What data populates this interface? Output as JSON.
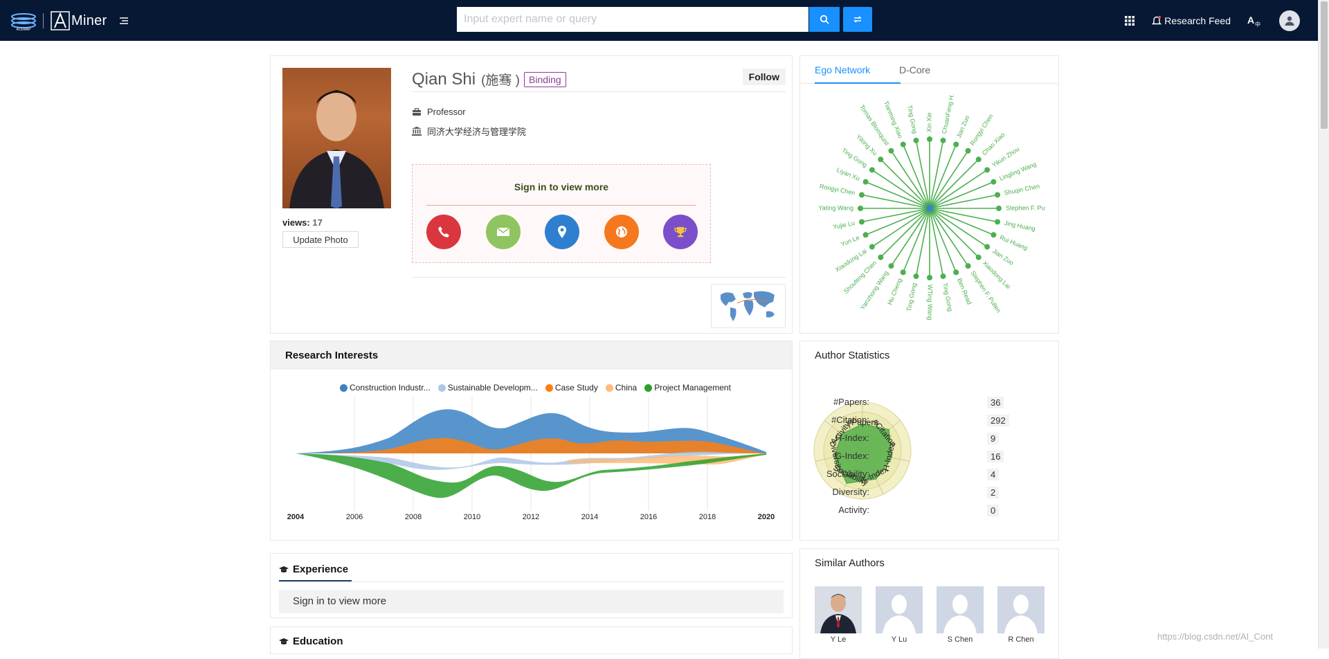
{
  "nav": {
    "brand": "Miner",
    "search_placeholder": "Input expert name or query",
    "research_feed": "Research Feed"
  },
  "profile": {
    "name": "Qian Shi",
    "chinese_name": "(施骞 )",
    "binding": "Binding",
    "follow": "Follow",
    "title": "Professor",
    "affiliation": "同济大学经济与管理学院",
    "views_label": "views:",
    "views_count": "17",
    "update_photo": "Update Photo",
    "signin_prompt": "Sign in to view more"
  },
  "ego": {
    "tabs": [
      "Ego Network",
      "D-Core"
    ],
    "nodes": [
      "Xin Xie",
      "ChuanFeng H.",
      "Jian Zuo",
      "Rongyi Chen",
      "Chao Xiao",
      "Yikun Zhou",
      "Lingling Wang",
      "Shuqin Chen",
      "Stephen F. Pu",
      "Jing Huang",
      "Rui Huang",
      "Jian Zuo",
      "Xiaodong Lai",
      "Stephen F. Pullen",
      "Ben Read",
      "Ting Gong",
      "WTing Wang",
      "Ting Gong",
      "Hu Cheng",
      "Yanzhong Wang",
      "Shoufeng Chen",
      "Xiaodong Lai",
      "Yun Le",
      "Yujie Lu",
      "Yating Wang",
      "Rongyi Chen",
      "Liyan Xu",
      "Ting Gong",
      "Yilong Xu",
      "Tomas Blomquist",
      "Tianming Xiao",
      "Ting Gong"
    ],
    "colors": {
      "line": "#4caf50",
      "center": "#3f7fd1",
      "text": "#4caf50"
    }
  },
  "research": {
    "title": "Research Interests",
    "legend": [
      {
        "label": "Construction Industr...",
        "color": "#3b82c4"
      },
      {
        "label": "Sustainable Developm...",
        "color": "#aec7e8"
      },
      {
        "label": "Case Study",
        "color": "#ff7f0e"
      },
      {
        "label": "China",
        "color": "#ffbb78"
      },
      {
        "label": "Project Management",
        "color": "#2ca02c"
      }
    ],
    "years": [
      "2004",
      "2006",
      "2008",
      "2010",
      "2012",
      "2014",
      "2016",
      "2018",
      "2020"
    ]
  },
  "stats": {
    "title": "Author Statistics",
    "axes": [
      "#Papers",
      "#Citation",
      "H-Index",
      "G-Index",
      "Sociability",
      "Diversity",
      "Activity"
    ],
    "items": [
      {
        "label": "#Papers:",
        "value": "36"
      },
      {
        "label": "#Citation:",
        "value": "292"
      },
      {
        "label": "H-Index:",
        "value": "9"
      },
      {
        "label": "G-Index:",
        "value": "16"
      },
      {
        "label": "Sociability:",
        "value": "4"
      },
      {
        "label": "Diversity:",
        "value": "2"
      },
      {
        "label": "Activity:",
        "value": "0"
      }
    ]
  },
  "experience": {
    "title": "Experience",
    "signin": "Sign in to view more"
  },
  "education": {
    "title": "Education"
  },
  "similar": {
    "title": "Similar Authors",
    "authors": [
      "Y Le",
      "Y Lu",
      "S Chen",
      "R Chen"
    ]
  },
  "watermark": "https://blog.csdn.net/AI_Cont"
}
